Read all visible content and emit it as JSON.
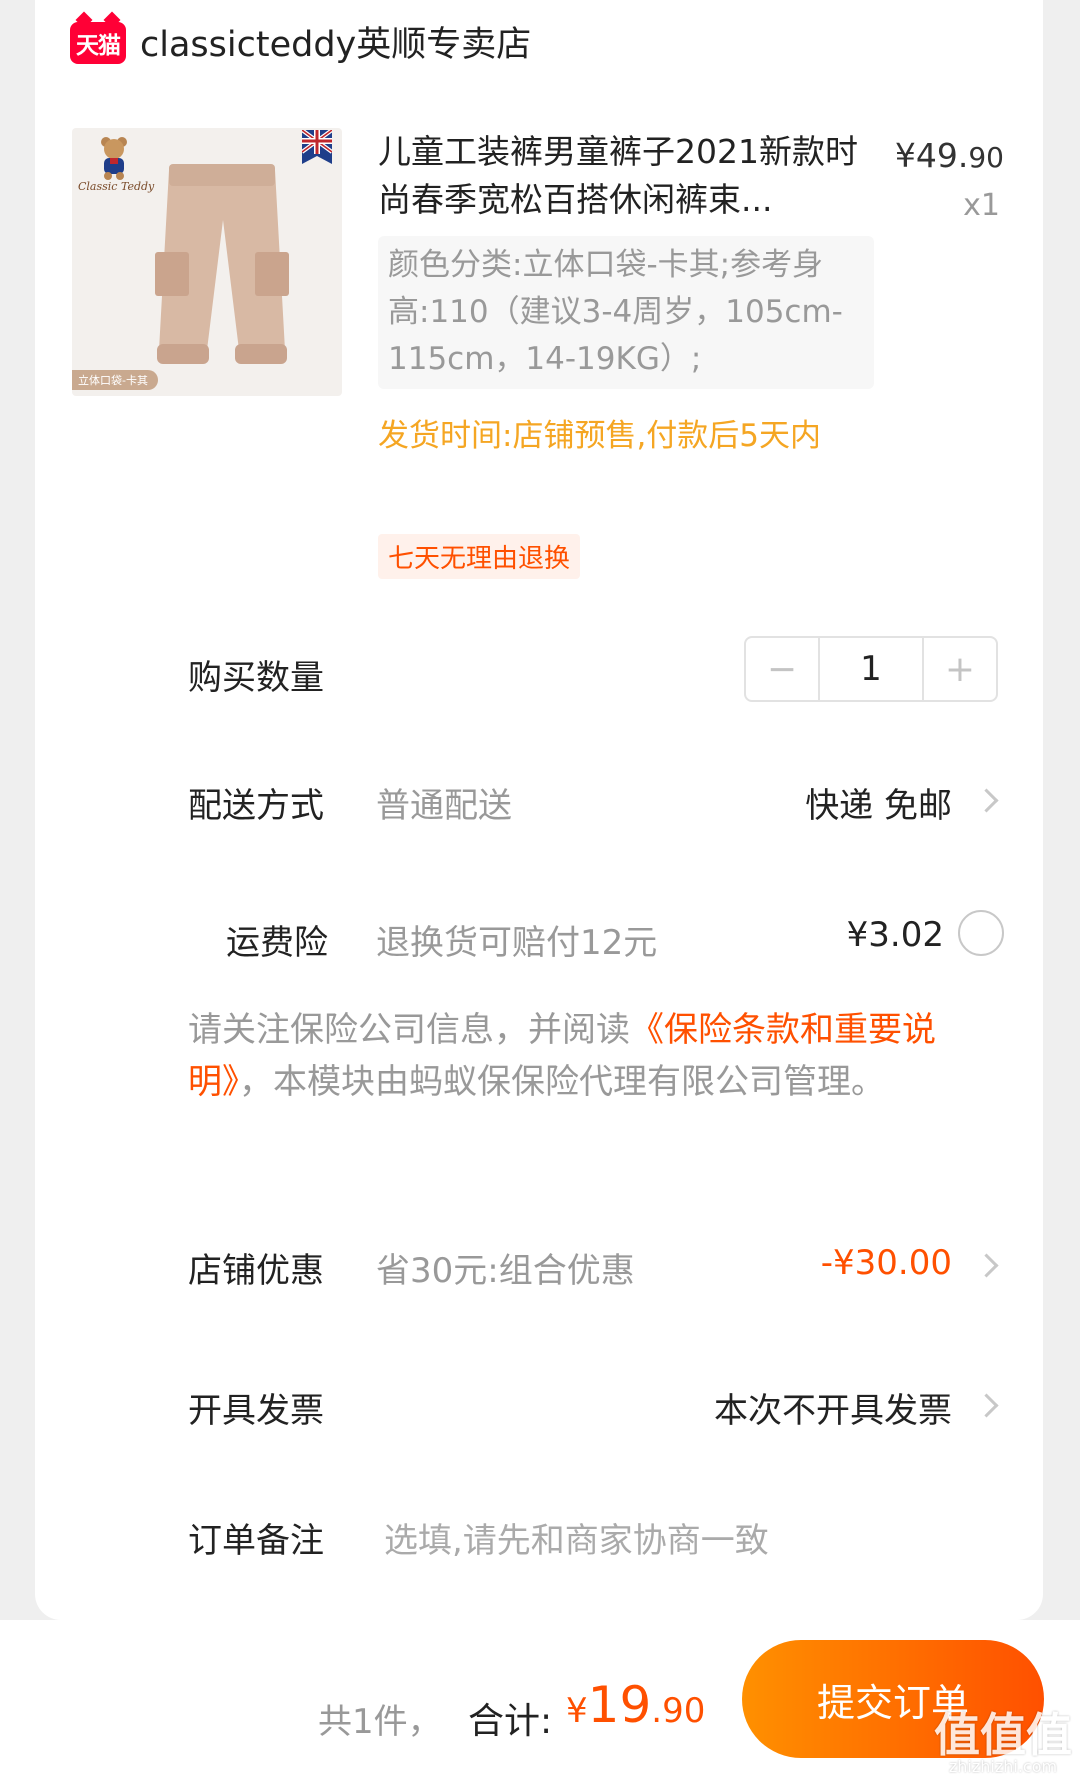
{
  "shop": {
    "platform_badge": "天猫",
    "name": "classicteddy英顺专卖店"
  },
  "product": {
    "title": "儿童工装裤男童裤子2021新款时尚春季宽松百搭休闲裤束...",
    "price_int": "¥49.",
    "price_dec": "90",
    "quantity_mark": "x1",
    "sku": "颜色分类:立体口袋-卡其;参考身高:110（建议3-4周岁，105cm-115cm，14-19KG）;",
    "ship_time": "发货时间:店铺预售,付款后5天内",
    "return_tag": "七天无理由退换",
    "image_tag": "立体口袋-卡其",
    "image_brand": "Classic Teddy"
  },
  "quantity": {
    "label": "购买数量",
    "value": "1",
    "minus": "−",
    "plus": "+"
  },
  "delivery": {
    "label": "配送方式",
    "method": "普通配送",
    "value": "快递 免邮"
  },
  "insurance": {
    "label": "运费险",
    "desc": "退换货可赔付12元",
    "price": "¥3.02",
    "notice_pre": "请关注保险公司信息，并阅读",
    "notice_link": "《保险条款和重要说明》",
    "notice_post": "，本模块由蚂蚁保保险代理有限公司管理。"
  },
  "discount": {
    "label": "店铺优惠",
    "desc": "省30元:组合优惠",
    "value": "-¥30.00"
  },
  "invoice": {
    "label": "开具发票",
    "value": "本次不开具发票"
  },
  "remark": {
    "label": "订单备注",
    "placeholder": "选填,请先和商家协商一致"
  },
  "footer": {
    "count": "共1件，",
    "total_label": "合计:",
    "total_currency": "¥",
    "total_int": "19",
    "total_dec": ".90",
    "submit": "提交订单"
  },
  "watermark": {
    "logo": "值值值",
    "site": "zhizhizhi.com"
  },
  "colors": {
    "accent": "#ff5000",
    "ship_time": "#f5a623",
    "tmall": "#ff0036"
  }
}
